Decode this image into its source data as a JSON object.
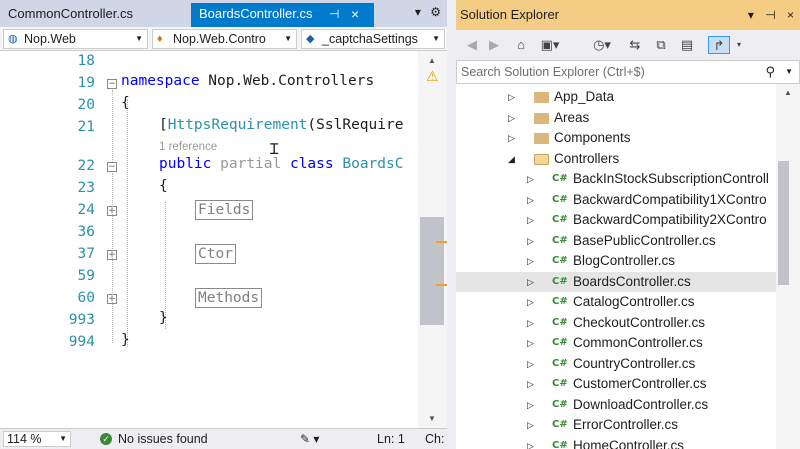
{
  "editor": {
    "tabs": [
      {
        "label": "CommonController.cs",
        "active": false
      },
      {
        "label": "BoardsController.cs",
        "active": true
      }
    ],
    "tab_icons": {
      "pin": "pin-icon",
      "close": "×"
    },
    "tabbar_icons": {
      "dropdown": "▾",
      "settings": "⚙"
    },
    "nav": {
      "project": "Nop.Web",
      "type": "Nop.Web.Contro",
      "member": "_captchaSettings"
    },
    "lines": [
      {
        "num": "18"
      },
      {
        "num": "19"
      },
      {
        "num": "20"
      },
      {
        "num": "21"
      },
      {
        "num": "22"
      },
      {
        "num": "23"
      },
      {
        "num": "24"
      },
      {
        "num": "36"
      },
      {
        "num": "37"
      },
      {
        "num": "59"
      },
      {
        "num": "60"
      },
      {
        "num": "993"
      },
      {
        "num": "994"
      }
    ],
    "code": {
      "namespace_kw": "namespace",
      "namespace_name": " Nop.Web.Controllers",
      "open_brace": "{",
      "attr_open": "[",
      "attr_name": "HttpsRequirement",
      "attr_rest": "(SslRequire",
      "codelens": "1 reference",
      "public_kw": "public",
      "partial_kw": "partial",
      "class_kw": "class",
      "class_name": "BoardsC",
      "region_fields": "Fields",
      "region_ctor": "Ctor",
      "region_methods": "Methods",
      "close_brace": "}"
    },
    "status": {
      "zoom": "114 %",
      "issues": "No issues found",
      "line": "Ln: 1",
      "col": "Ch:"
    }
  },
  "solution_explorer": {
    "title": "Solution Explorer",
    "search_placeholder": "Search Solution Explorer (Ctrl+$)",
    "tree": [
      {
        "label": "App_Data",
        "kind": "folder",
        "expanded": false,
        "level": 0
      },
      {
        "label": "Areas",
        "kind": "folder",
        "expanded": false,
        "level": 0
      },
      {
        "label": "Components",
        "kind": "folder",
        "expanded": false,
        "level": 0
      },
      {
        "label": "Controllers",
        "kind": "folder",
        "expanded": true,
        "level": 0
      },
      {
        "label": "BackInStockSubscriptionControll",
        "kind": "cs",
        "level": 1
      },
      {
        "label": "BackwardCompatibility1XContro",
        "kind": "cs",
        "level": 1
      },
      {
        "label": "BackwardCompatibility2XContro",
        "kind": "cs",
        "level": 1
      },
      {
        "label": "BasePublicController.cs",
        "kind": "cs",
        "level": 1
      },
      {
        "label": "BlogController.cs",
        "kind": "cs",
        "level": 1
      },
      {
        "label": "BoardsController.cs",
        "kind": "cs",
        "level": 1,
        "selected": true
      },
      {
        "label": "CatalogController.cs",
        "kind": "cs",
        "level": 1
      },
      {
        "label": "CheckoutController.cs",
        "kind": "cs",
        "level": 1
      },
      {
        "label": "CommonController.cs",
        "kind": "cs",
        "level": 1
      },
      {
        "label": "CountryController.cs",
        "kind": "cs",
        "level": 1
      },
      {
        "label": "CustomerController.cs",
        "kind": "cs",
        "level": 1
      },
      {
        "label": "DownloadController.cs",
        "kind": "cs",
        "level": 1
      },
      {
        "label": "ErrorController.cs",
        "kind": "cs",
        "level": 1
      },
      {
        "label": "HomeController.cs",
        "kind": "cs",
        "level": 1
      }
    ],
    "cs_badge": "C#",
    "colors": {
      "title_bg": "#f5cc84",
      "cs_icon": "#388a34",
      "folder": "#dcb67a"
    }
  },
  "colors": {
    "active_tab": "#007acc",
    "line_numbers": "#2b91af",
    "keyword": "#0000ff",
    "type": "#2b91af"
  }
}
